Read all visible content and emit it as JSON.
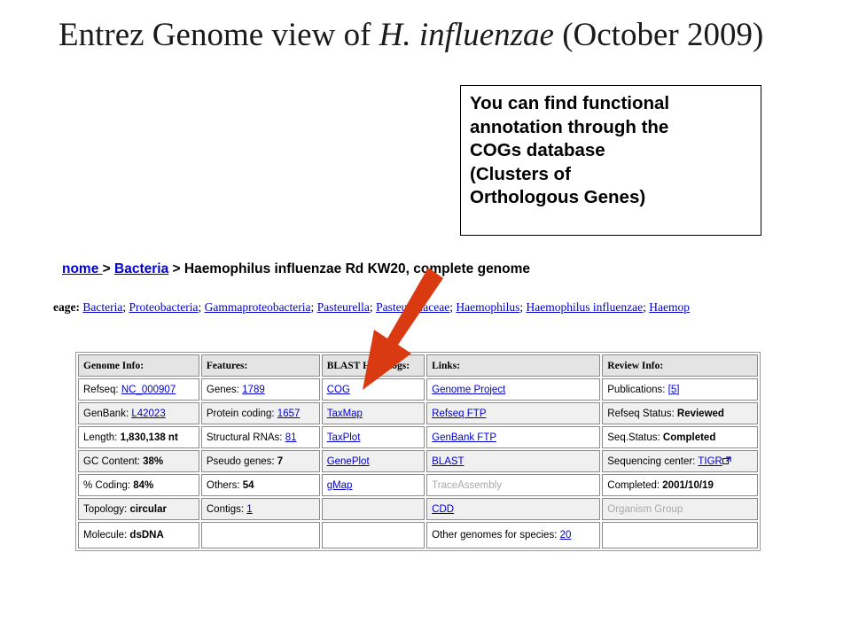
{
  "title": {
    "prefix": "Entrez Genome view of ",
    "italic": "H. influenzae",
    "suffix": " (October 2009)"
  },
  "callout": {
    "lines": [
      "You can find functional",
      "annotation through the",
      "COGs database",
      "(Clusters of",
      "Orthologous Genes)"
    ]
  },
  "breadcrumb": {
    "genome": "nome ",
    "sep1": " > ",
    "bacteria": "Bacteria",
    "sep2": " > ",
    "current": "Haemophilus influenzae Rd KW20, complete genome"
  },
  "lineage": {
    "label": "eage: ",
    "items": [
      "Bacteria",
      "Proteobacteria",
      "Gammaproteobacteria",
      "Pasteurella",
      "Pasteurellaceae",
      "Haemophilus",
      "Haemophilus influenzae",
      "Haemop"
    ]
  },
  "table": {
    "headers": [
      "Genome Info:",
      "Features:",
      "BLAST Homologs:",
      "Links:",
      "Review Info:"
    ],
    "col1": [
      {
        "label": "Refseq: ",
        "link": "NC_000907"
      },
      {
        "label": "GenBank: ",
        "link": "L42023"
      },
      {
        "label": "Length: ",
        "value": "1,830,138 nt"
      },
      {
        "label": "GC Content: ",
        "value": "38%"
      },
      {
        "label": "% Coding: ",
        "value": "84%"
      },
      {
        "label": "Topology: ",
        "value": "circular"
      },
      {
        "label": "Molecule: ",
        "value": "dsDNA"
      }
    ],
    "col2": [
      {
        "label": "Genes: ",
        "link": "1789"
      },
      {
        "label": "Protein coding: ",
        "link": "1657"
      },
      {
        "label": "Structural RNAs: ",
        "link": "81"
      },
      {
        "label": "Pseudo genes: ",
        "value": "7"
      },
      {
        "label": "Others: ",
        "value": "54"
      },
      {
        "label": "Contigs: ",
        "link": "1"
      }
    ],
    "col3": [
      "COG",
      "TaxMap",
      "TaxPlot",
      "GenePlot",
      "gMap"
    ],
    "col4": [
      "Genome Project",
      "Refseq FTP",
      "GenBank FTP",
      "BLAST",
      "TraceAssembly",
      "CDD"
    ],
    "col4_last": {
      "label": "Other genomes for species: ",
      "link": "20"
    },
    "col5": [
      {
        "label": "Publications: ",
        "link": "[5]"
      },
      {
        "label": "Refseq Status: ",
        "value": "Reviewed"
      },
      {
        "label": "Seq.Status: ",
        "value": "Completed"
      },
      {
        "label": "Sequencing center: ",
        "link": "TIGR"
      },
      {
        "label": "Completed: ",
        "value": "2001/10/19"
      },
      {
        "label": "Organism Group"
      }
    ],
    "external_link_icon": "external-link-icon"
  },
  "colors": {
    "link": "#0000cc",
    "arrow": "#d93a12",
    "header_bg": "#e4e4e4"
  }
}
